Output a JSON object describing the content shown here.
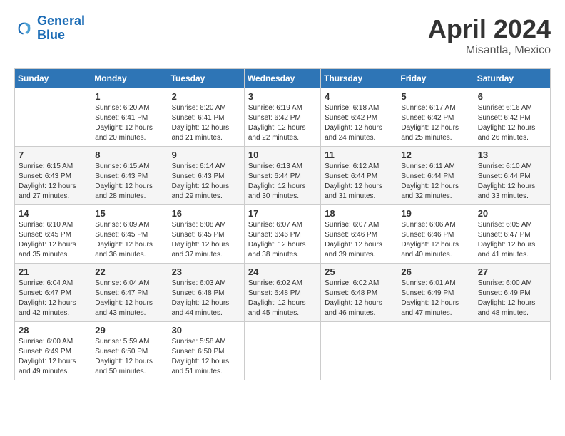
{
  "header": {
    "logo_line1": "General",
    "logo_line2": "Blue",
    "month": "April 2024",
    "location": "Misantla, Mexico"
  },
  "weekdays": [
    "Sunday",
    "Monday",
    "Tuesday",
    "Wednesday",
    "Thursday",
    "Friday",
    "Saturday"
  ],
  "weeks": [
    [
      {
        "day": "",
        "info": ""
      },
      {
        "day": "1",
        "info": "Sunrise: 6:20 AM\nSunset: 6:41 PM\nDaylight: 12 hours\nand 20 minutes."
      },
      {
        "day": "2",
        "info": "Sunrise: 6:20 AM\nSunset: 6:41 PM\nDaylight: 12 hours\nand 21 minutes."
      },
      {
        "day": "3",
        "info": "Sunrise: 6:19 AM\nSunset: 6:42 PM\nDaylight: 12 hours\nand 22 minutes."
      },
      {
        "day": "4",
        "info": "Sunrise: 6:18 AM\nSunset: 6:42 PM\nDaylight: 12 hours\nand 24 minutes."
      },
      {
        "day": "5",
        "info": "Sunrise: 6:17 AM\nSunset: 6:42 PM\nDaylight: 12 hours\nand 25 minutes."
      },
      {
        "day": "6",
        "info": "Sunrise: 6:16 AM\nSunset: 6:42 PM\nDaylight: 12 hours\nand 26 minutes."
      }
    ],
    [
      {
        "day": "7",
        "info": "Sunrise: 6:15 AM\nSunset: 6:43 PM\nDaylight: 12 hours\nand 27 minutes."
      },
      {
        "day": "8",
        "info": "Sunrise: 6:15 AM\nSunset: 6:43 PM\nDaylight: 12 hours\nand 28 minutes."
      },
      {
        "day": "9",
        "info": "Sunrise: 6:14 AM\nSunset: 6:43 PM\nDaylight: 12 hours\nand 29 minutes."
      },
      {
        "day": "10",
        "info": "Sunrise: 6:13 AM\nSunset: 6:44 PM\nDaylight: 12 hours\nand 30 minutes."
      },
      {
        "day": "11",
        "info": "Sunrise: 6:12 AM\nSunset: 6:44 PM\nDaylight: 12 hours\nand 31 minutes."
      },
      {
        "day": "12",
        "info": "Sunrise: 6:11 AM\nSunset: 6:44 PM\nDaylight: 12 hours\nand 32 minutes."
      },
      {
        "day": "13",
        "info": "Sunrise: 6:10 AM\nSunset: 6:44 PM\nDaylight: 12 hours\nand 33 minutes."
      }
    ],
    [
      {
        "day": "14",
        "info": "Sunrise: 6:10 AM\nSunset: 6:45 PM\nDaylight: 12 hours\nand 35 minutes."
      },
      {
        "day": "15",
        "info": "Sunrise: 6:09 AM\nSunset: 6:45 PM\nDaylight: 12 hours\nand 36 minutes."
      },
      {
        "day": "16",
        "info": "Sunrise: 6:08 AM\nSunset: 6:45 PM\nDaylight: 12 hours\nand 37 minutes."
      },
      {
        "day": "17",
        "info": "Sunrise: 6:07 AM\nSunset: 6:46 PM\nDaylight: 12 hours\nand 38 minutes."
      },
      {
        "day": "18",
        "info": "Sunrise: 6:07 AM\nSunset: 6:46 PM\nDaylight: 12 hours\nand 39 minutes."
      },
      {
        "day": "19",
        "info": "Sunrise: 6:06 AM\nSunset: 6:46 PM\nDaylight: 12 hours\nand 40 minutes."
      },
      {
        "day": "20",
        "info": "Sunrise: 6:05 AM\nSunset: 6:47 PM\nDaylight: 12 hours\nand 41 minutes."
      }
    ],
    [
      {
        "day": "21",
        "info": "Sunrise: 6:04 AM\nSunset: 6:47 PM\nDaylight: 12 hours\nand 42 minutes."
      },
      {
        "day": "22",
        "info": "Sunrise: 6:04 AM\nSunset: 6:47 PM\nDaylight: 12 hours\nand 43 minutes."
      },
      {
        "day": "23",
        "info": "Sunrise: 6:03 AM\nSunset: 6:48 PM\nDaylight: 12 hours\nand 44 minutes."
      },
      {
        "day": "24",
        "info": "Sunrise: 6:02 AM\nSunset: 6:48 PM\nDaylight: 12 hours\nand 45 minutes."
      },
      {
        "day": "25",
        "info": "Sunrise: 6:02 AM\nSunset: 6:48 PM\nDaylight: 12 hours\nand 46 minutes."
      },
      {
        "day": "26",
        "info": "Sunrise: 6:01 AM\nSunset: 6:49 PM\nDaylight: 12 hours\nand 47 minutes."
      },
      {
        "day": "27",
        "info": "Sunrise: 6:00 AM\nSunset: 6:49 PM\nDaylight: 12 hours\nand 48 minutes."
      }
    ],
    [
      {
        "day": "28",
        "info": "Sunrise: 6:00 AM\nSunset: 6:49 PM\nDaylight: 12 hours\nand 49 minutes."
      },
      {
        "day": "29",
        "info": "Sunrise: 5:59 AM\nSunset: 6:50 PM\nDaylight: 12 hours\nand 50 minutes."
      },
      {
        "day": "30",
        "info": "Sunrise: 5:58 AM\nSunset: 6:50 PM\nDaylight: 12 hours\nand 51 minutes."
      },
      {
        "day": "",
        "info": ""
      },
      {
        "day": "",
        "info": ""
      },
      {
        "day": "",
        "info": ""
      },
      {
        "day": "",
        "info": ""
      }
    ]
  ]
}
